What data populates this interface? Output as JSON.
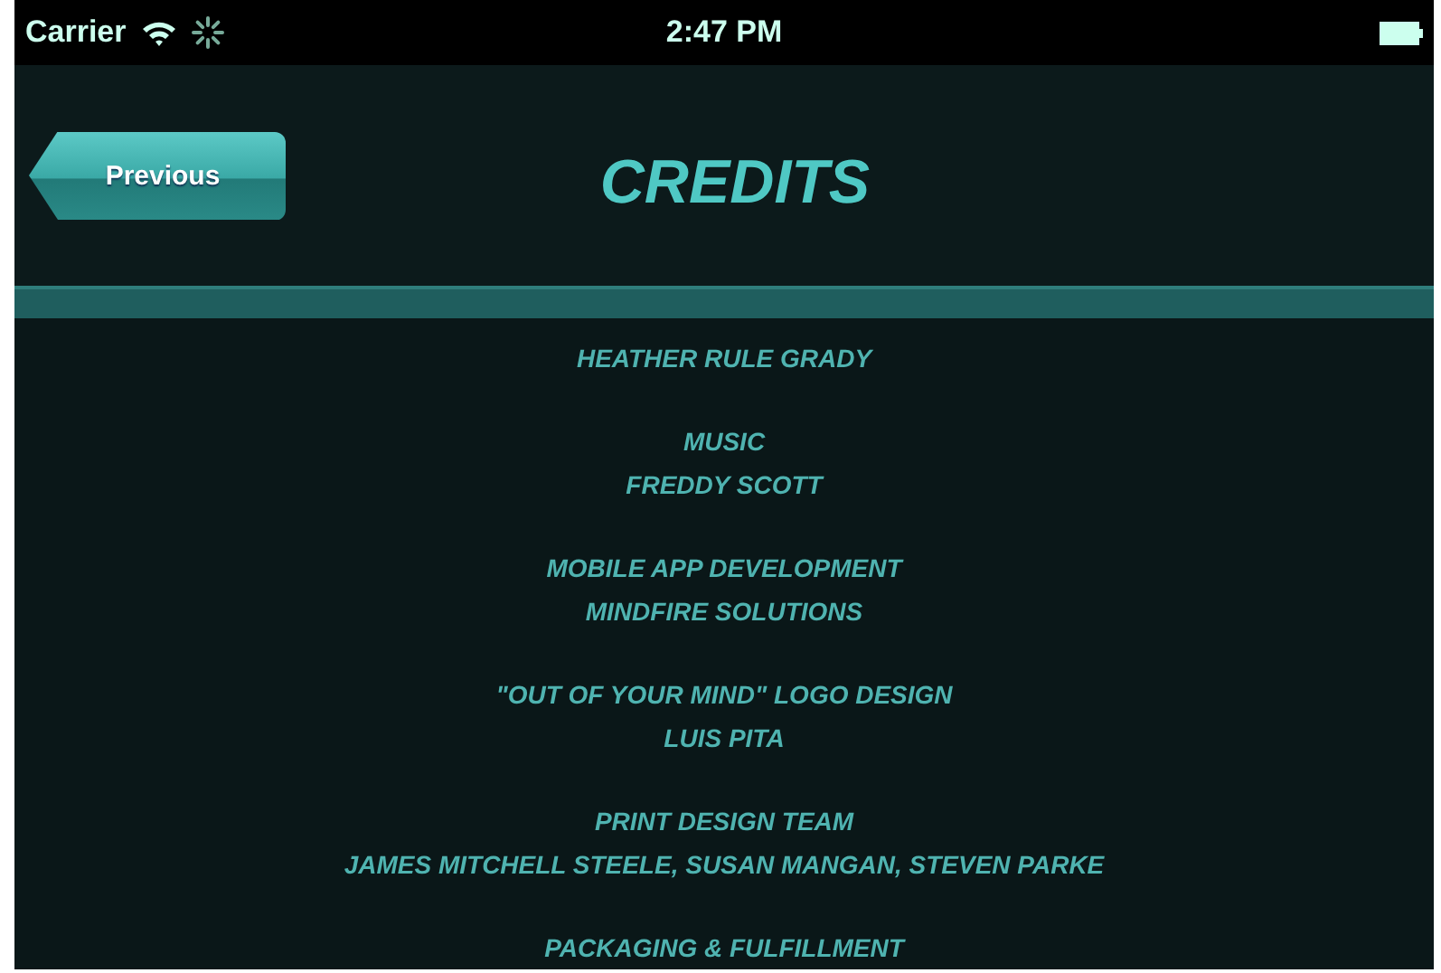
{
  "status_bar": {
    "carrier": "Carrier",
    "time": "2:47 PM"
  },
  "header": {
    "back_button": "Previous",
    "title": "CREDITS"
  },
  "credits": [
    {
      "lines": [
        "HEATHER RULE GRADY"
      ]
    },
    {
      "lines": [
        "MUSIC",
        "FREDDY SCOTT"
      ]
    },
    {
      "lines": [
        "MOBILE APP DEVELOPMENT",
        "MINDFIRE SOLUTIONS"
      ]
    },
    {
      "lines": [
        "\"OUT OF YOUR MIND\" LOGO DESIGN",
        "LUIS PITA"
      ]
    },
    {
      "lines": [
        "PRINT DESIGN TEAM",
        "JAMES MITCHELL STEELE, SUSAN MANGAN, STEVEN PARKE"
      ]
    },
    {
      "lines": [
        "PACKAGING & FULFILLMENT"
      ]
    }
  ]
}
